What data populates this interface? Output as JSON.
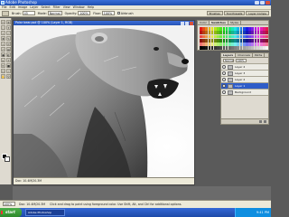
{
  "window": {
    "title": "Adobe Photoshop"
  },
  "menu": [
    "File",
    "Edit",
    "Image",
    "Layer",
    "Select",
    "Filter",
    "View",
    "Window",
    "Help"
  ],
  "options_bar": {
    "brush_label": "Brush:",
    "brush_size": "45",
    "mode_label": "Mode:",
    "mode_value": "Normal",
    "opacity_label": "Opacity:",
    "opacity_value": "100%",
    "flow_label": "Flow:",
    "flow_value": "100%",
    "airbrush_label": "Airbrush",
    "palette_tabs": [
      "Brushes",
      "Tool Presets",
      "Layer Comps"
    ]
  },
  "document": {
    "title": "Polar bear.psd @ 100% (Layer 1, RGB)",
    "status": "Doc: 10.4M/20.3M"
  },
  "swatches_panel": {
    "tabs": [
      "Color",
      "Swatches",
      "Styles"
    ]
  },
  "layers_panel": {
    "tabs": [
      "Layers",
      "Channels",
      "Paths"
    ],
    "blend_mode": "Normal",
    "opacity": "100%",
    "fill_label": "Fill:",
    "layers": [
      {
        "name": "Layer 4"
      },
      {
        "name": "Layer 3"
      },
      {
        "name": "Layer 2"
      },
      {
        "name": "Layer 1",
        "selected": true
      },
      {
        "name": "Background"
      }
    ]
  },
  "app_status": {
    "zoom": "100%",
    "doc": "Doc: 10.4M/20.3M",
    "hint": "Click and drag to paint using foreground color. Use Shift, Alt, and Ctrl for additional options."
  },
  "taskbar": {
    "start": "start",
    "items": [
      "Adobe Photoshop"
    ],
    "clock": "9:41 PM"
  },
  "colors": {
    "xp_blue": "#2553b5",
    "xp_green": "#3a9a38",
    "panel_bg": "#dedad0",
    "selected": "#2e5cc8"
  }
}
